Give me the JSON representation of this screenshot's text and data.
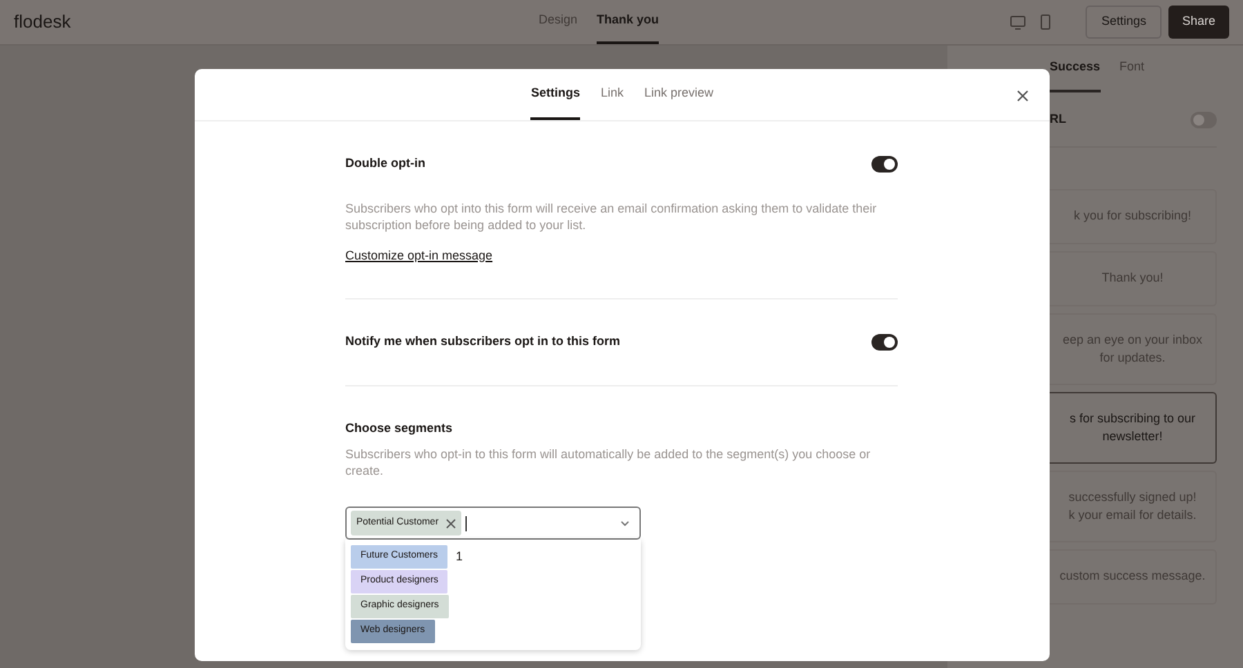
{
  "header": {
    "logo": "flodesk",
    "tabs": [
      {
        "label": "Design",
        "selected": false
      },
      {
        "label": "Thank you",
        "selected": true
      }
    ],
    "buttons": [
      {
        "label": "Settings",
        "kind": "outline"
      },
      {
        "label": "Share",
        "kind": "primary"
      }
    ]
  },
  "side_panel": {
    "tabs": [
      {
        "label": "Success",
        "selected": true
      },
      {
        "label": "Font",
        "selected": false
      }
    ],
    "setting": {
      "label": "RL",
      "on": false
    },
    "messages": [
      {
        "lines": [
          "k you for subscribing!"
        ],
        "selected": false
      },
      {
        "lines": [
          "Thank you!"
        ],
        "selected": false
      },
      {
        "lines": [
          "eep an eye on your inbox",
          "for updates."
        ],
        "selected": false
      },
      {
        "lines": [
          "s for subscribing to our",
          "newsletter!"
        ],
        "selected": true
      },
      {
        "lines": [
          "successfully signed up!",
          "k your email for details."
        ],
        "selected": false
      },
      {
        "lines": [
          "custom success message."
        ],
        "selected": false
      }
    ]
  },
  "modal": {
    "tabs": [
      {
        "label": "Settings",
        "selected": true
      },
      {
        "label": "Link",
        "selected": false
      },
      {
        "label": "Link preview",
        "selected": false
      }
    ],
    "settings": [
      {
        "title": "Double opt-in",
        "on": true,
        "description": "Subscribers who opt into this form will receive an email confirmation asking them to validate their subscription before being added to your list.",
        "link": "Customize opt-in message"
      },
      {
        "title": "Notify me when subscribers opt in to this form",
        "on": true
      }
    ],
    "segments": {
      "title": "Choose segments",
      "description": "Subscribers who opt-in to this form will automatically be added to the segment(s) you choose or create.",
      "selected": [
        {
          "label": "Potential Customer",
          "color": "#d4ddd6"
        }
      ],
      "options": [
        {
          "label": "Future Customers",
          "color": "#b9cdeb",
          "note": "1"
        },
        {
          "label": "Product designers",
          "color": "#d9d3f5"
        },
        {
          "label": "Graphic designers",
          "color": "#d3ddd6"
        },
        {
          "label": "Web designers",
          "color": "#7f95b0"
        }
      ]
    }
  }
}
